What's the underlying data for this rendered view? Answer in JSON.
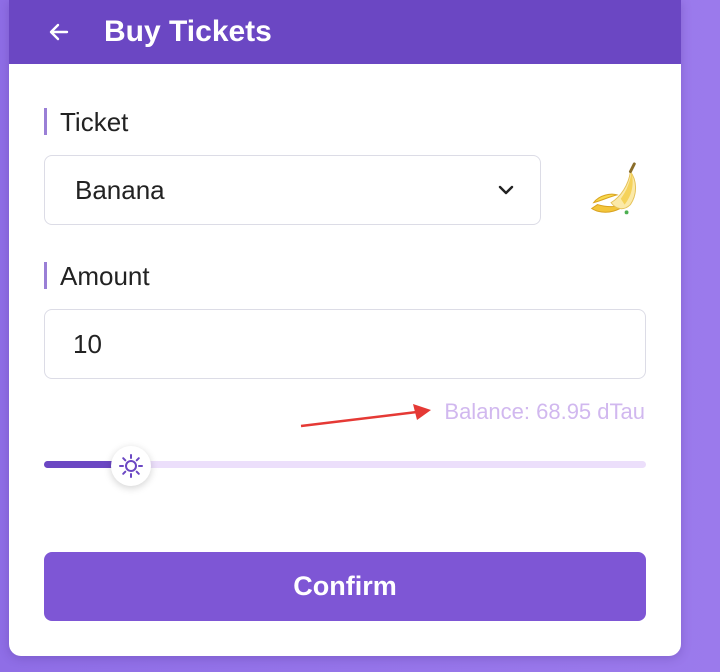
{
  "header": {
    "title": "Buy Tickets",
    "back_icon": "arrow-left-icon"
  },
  "ticket": {
    "label": "Ticket",
    "selected": "Banana",
    "icon": "banana-icon"
  },
  "amount": {
    "label": "Amount",
    "value": "10"
  },
  "balance": {
    "text": "Balance: 68.95 dTau"
  },
  "slider": {
    "level_percent": 14.5,
    "thumb_icon": "sun-icon"
  },
  "confirm_label": "Confirm",
  "colors": {
    "header": "#6b47c3",
    "accent": "#7e56d5",
    "balance_text": "#d1b8ef",
    "slider_track": "#ecdffb",
    "annotation_arrow": "#e53935"
  }
}
